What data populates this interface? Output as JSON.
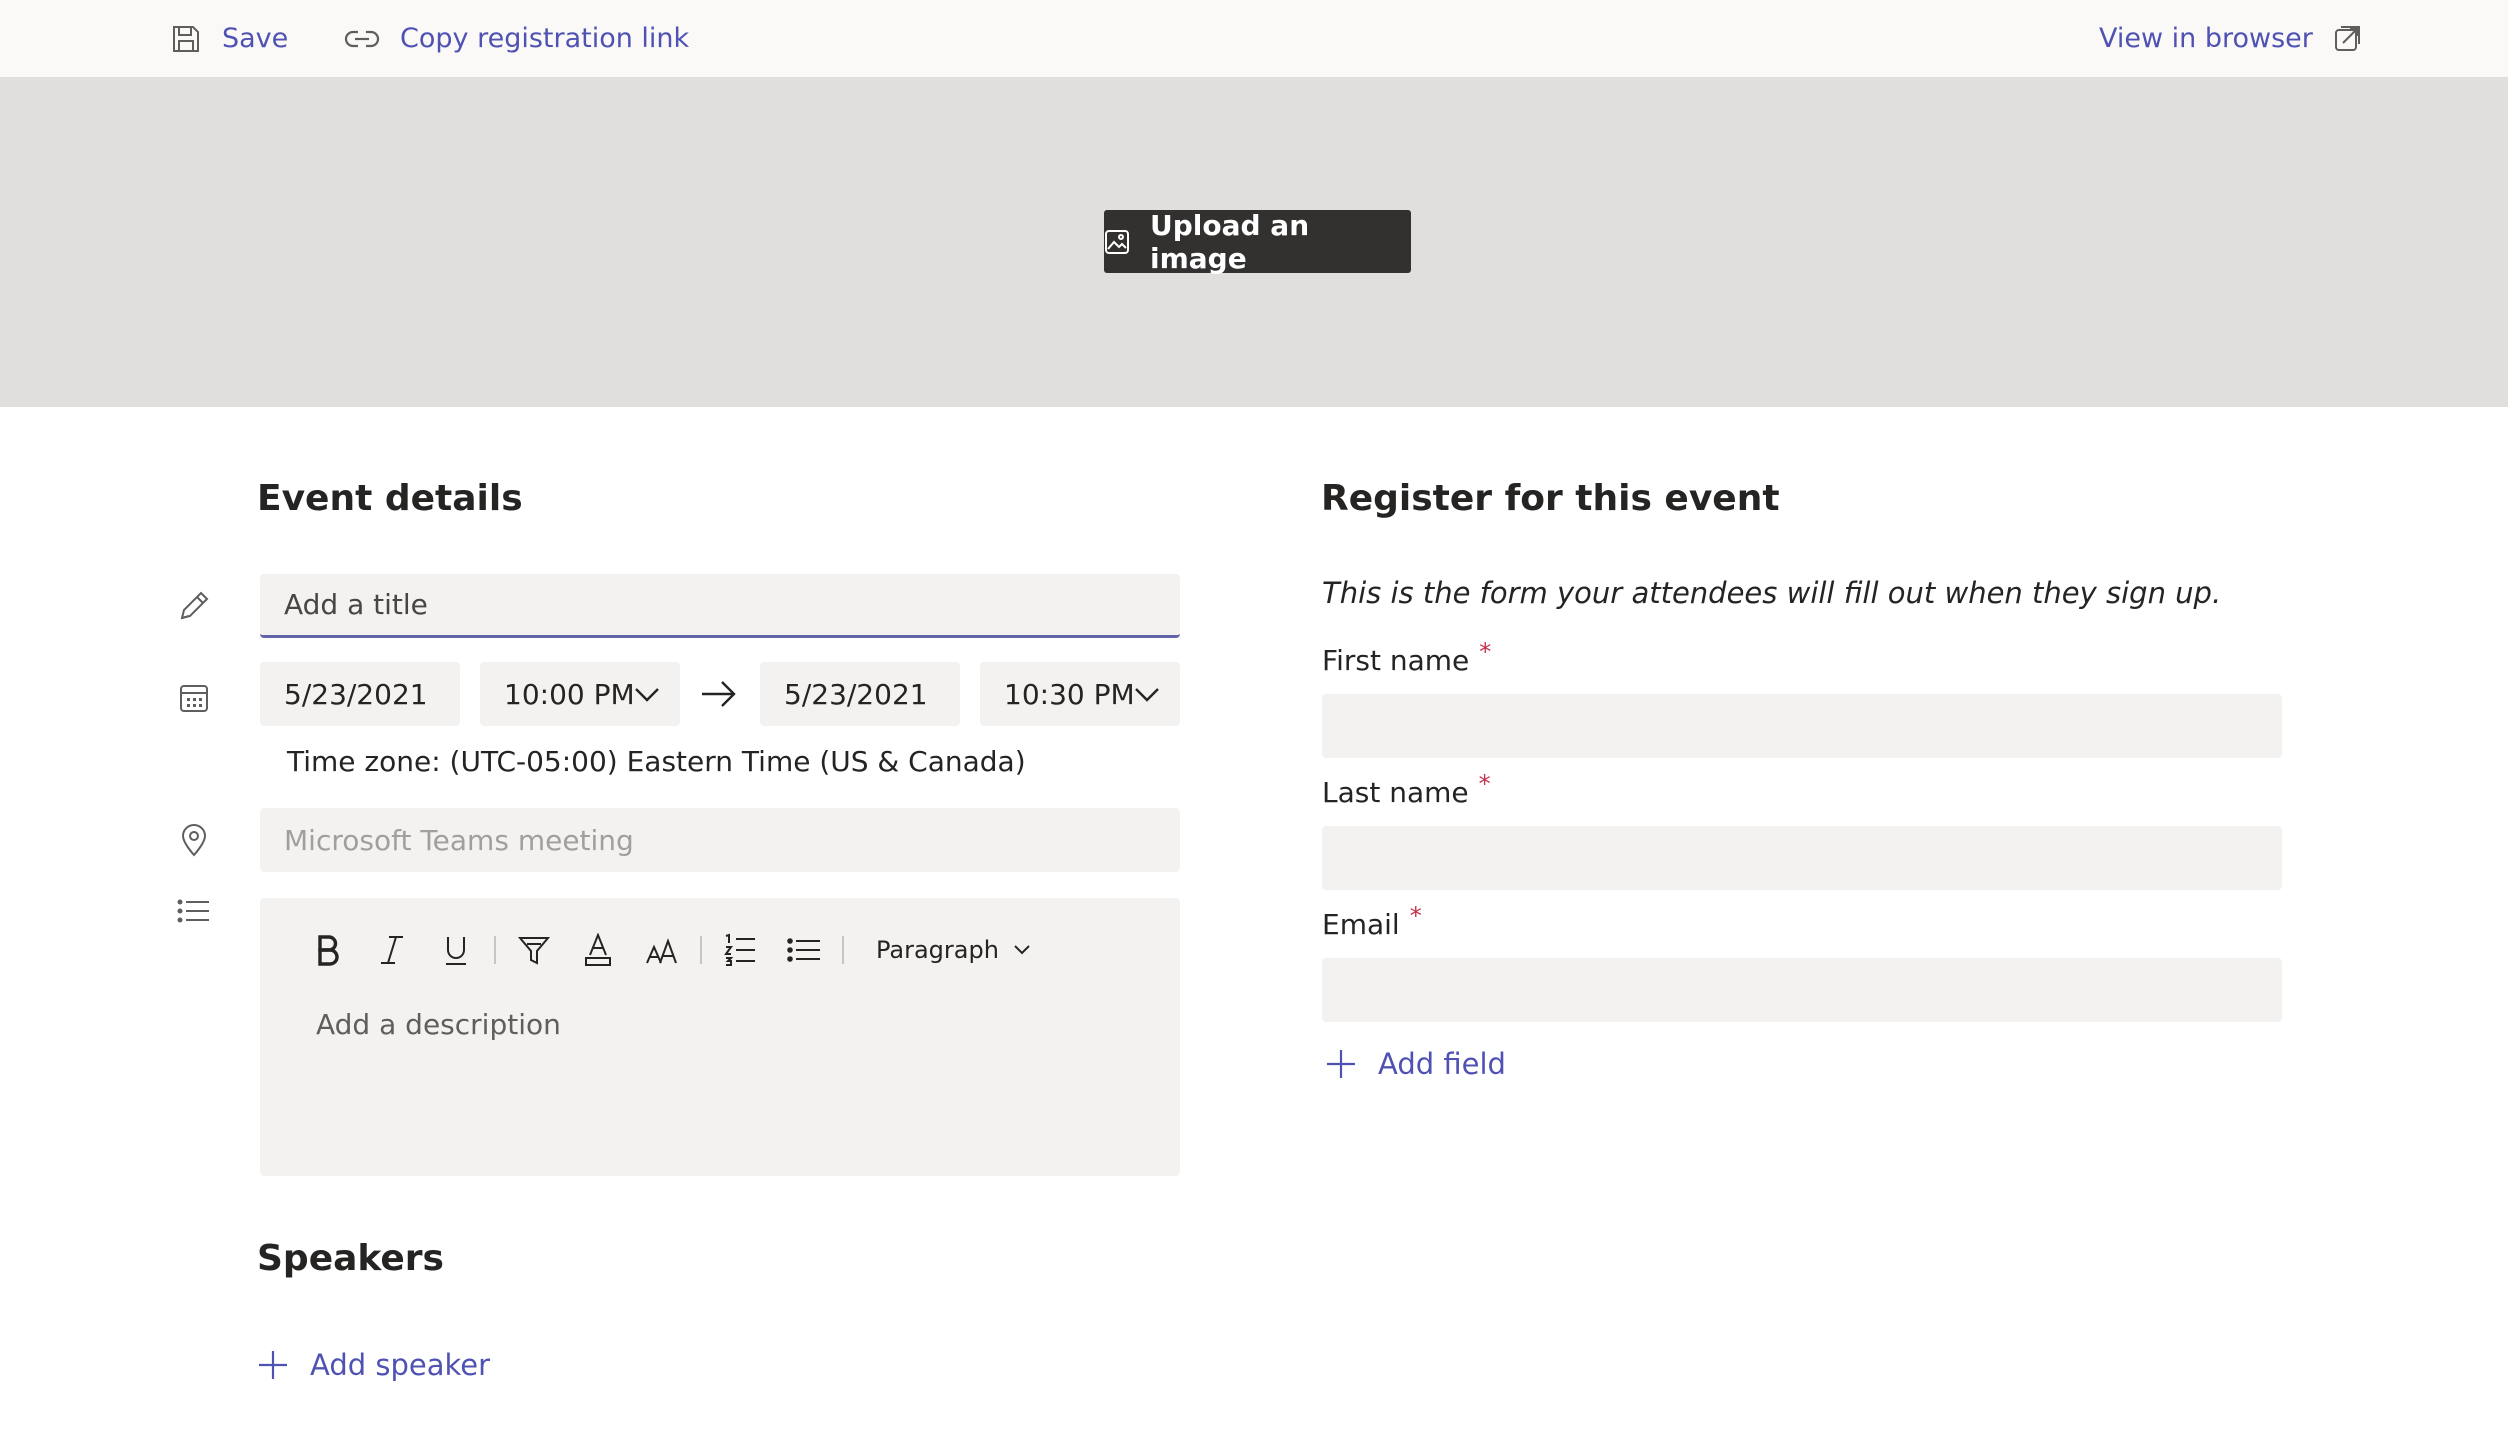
{
  "toolbar": {
    "save_label": "Save",
    "copy_link_label": "Copy registration link",
    "view_browser_label": "View in browser"
  },
  "banner": {
    "upload_label": "Upload an image"
  },
  "event_details": {
    "heading": "Event details",
    "title_placeholder": "Add a title",
    "start_date": "5/23/2021",
    "start_time": "10:00 PM",
    "end_date": "5/23/2021",
    "end_time": "10:30 PM",
    "timezone": "Time zone: (UTC-05:00) Eastern Time (US & Canada)",
    "location_placeholder": "Microsoft Teams meeting",
    "description_placeholder": "Add a description",
    "paragraph_style": "Paragraph"
  },
  "speakers": {
    "heading": "Speakers",
    "add_label": "Add speaker"
  },
  "registration": {
    "heading": "Register for this event",
    "note": "This is the form your attendees will fill out when they sign up.",
    "fields": [
      {
        "label": "First name",
        "required_mark": "*"
      },
      {
        "label": "Last name",
        "required_mark": "*"
      },
      {
        "label": "Email",
        "required_mark": "*"
      }
    ],
    "add_field_label": "Add field"
  },
  "colors": {
    "accent": "#4f52b2",
    "title_underline": "#6264a7",
    "required": "#c4314b",
    "banner": "#e1dfdd",
    "field_bg": "#f3f2f1",
    "upload_button": "#323130"
  }
}
